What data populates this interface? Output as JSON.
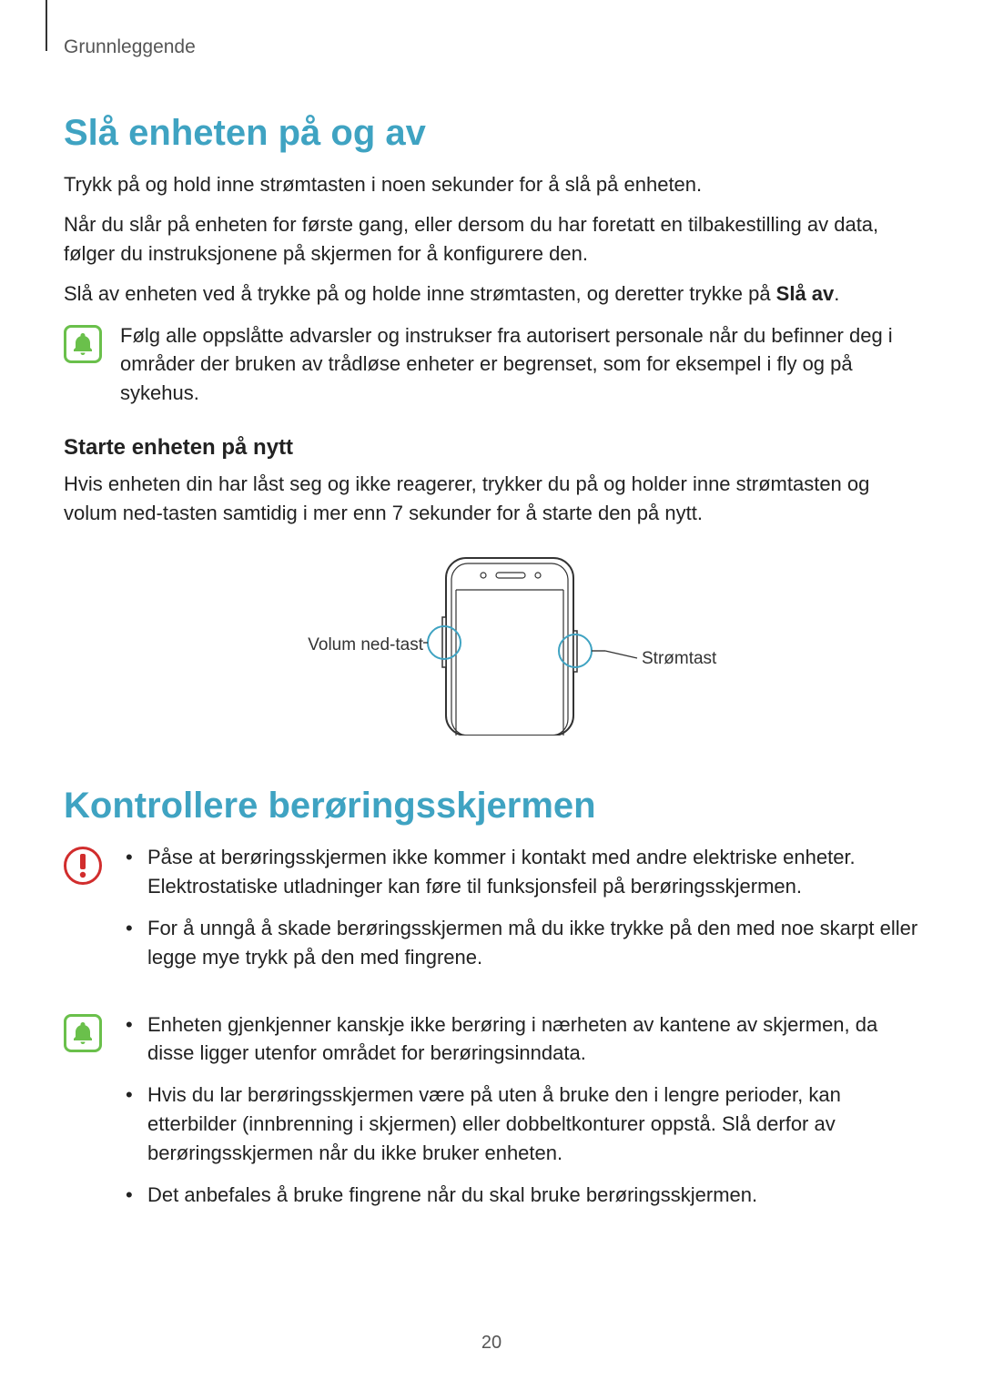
{
  "header": "Grunnleggende",
  "h1a": "Slå enheten på og av",
  "p1": "Trykk på og hold inne strømtasten i noen sekunder for å slå på enheten.",
  "p2": "Når du slår på enheten for første gang, eller dersom du har foretatt en tilbakestilling av data, følger du instruksjonene på skjermen for å konfigurere den.",
  "p3a": "Slå av enheten ved å trykke på og holde inne strømtasten, og deretter trykke på ",
  "p3b": "Slå av",
  "p3c": ".",
  "note1": "Følg alle oppslåtte advarsler og instrukser fra autorisert personale når du befinner deg i områder der bruken av trådløse enheter er begrenset, som for eksempel i fly og på sykehus.",
  "h2a": "Starte enheten på nytt",
  "p4": "Hvis enheten din har låst seg og ikke reagerer, trykker du på og holder inne strømtasten og volum ned-tasten samtidig i mer enn 7 sekunder for å starte den på nytt.",
  "diagram": {
    "left_label": "Volum ned-tast",
    "right_label": "Strømtast"
  },
  "h1b": "Kontrollere berøringsskjermen",
  "warn_list": [
    "Påse at berøringsskjermen ikke kommer i kontakt med andre elektriske enheter. Elektrostatiske utladninger kan føre til funksjonsfeil på berøringsskjermen.",
    "For å unngå å skade berøringsskjermen må du ikke trykke på den med noe skarpt eller legge mye trykk på den med fingrene."
  ],
  "info_list": [
    "Enheten gjenkjenner kanskje ikke berøring i nærheten av kantene av skjermen, da disse ligger utenfor området for berøringsinndata.",
    "Hvis du lar berøringsskjermen være på uten å bruke den i lengre perioder, kan etterbilder (innbrenning i skjermen) eller dobbeltkonturer oppstå. Slå derfor av berøringsskjermen når du ikke bruker enheten.",
    "Det anbefales å bruke fingrene når du skal bruke berøringsskjermen."
  ],
  "page_number": "20"
}
